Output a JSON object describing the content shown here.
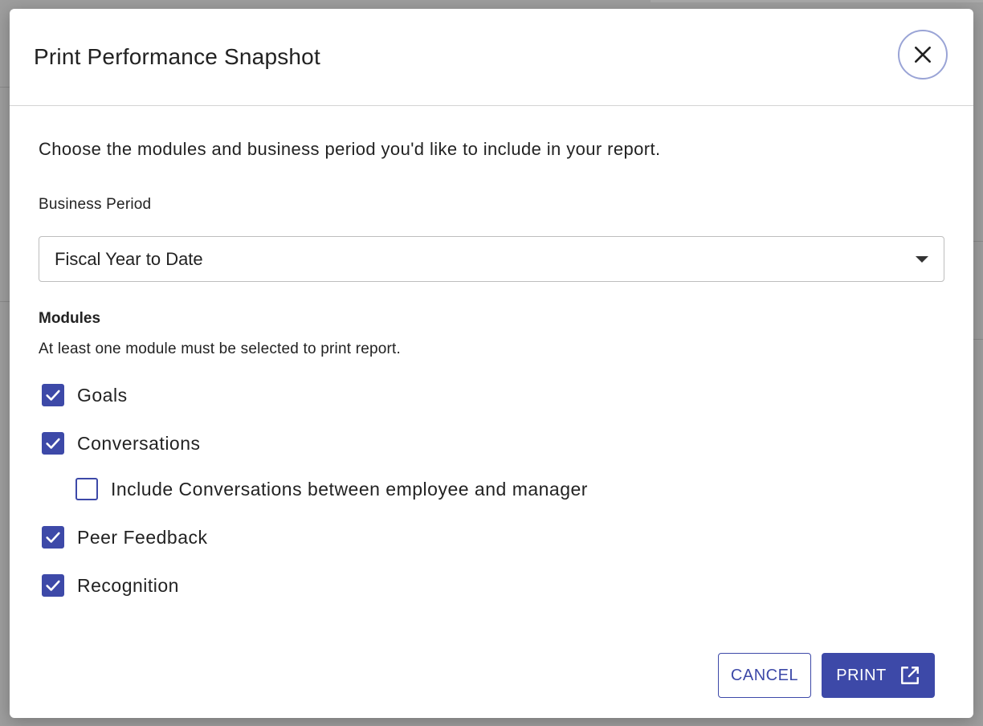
{
  "dialog": {
    "title": "Print Performance Snapshot",
    "intro": "Choose the modules and business period you'd like to include in your report."
  },
  "business_period": {
    "label": "Business Period",
    "selected": "Fiscal Year to Date"
  },
  "modules": {
    "title": "Modules",
    "help": "At least one module must be selected to print report.",
    "items": [
      {
        "label": "Goals",
        "checked": true
      },
      {
        "label": "Conversations",
        "checked": true
      },
      {
        "label": "Include Conversations between employee and manager",
        "checked": false
      },
      {
        "label": "Peer Feedback",
        "checked": true
      },
      {
        "label": "Recognition",
        "checked": true
      }
    ]
  },
  "actions": {
    "cancel_label": "CANCEL",
    "print_label": "PRINT"
  },
  "colors": {
    "accent": "#3d49a8",
    "close_ring": "#9aa4d6"
  },
  "icons": {
    "close": "close-icon",
    "caret": "caret-down-icon",
    "check": "check-icon",
    "external": "open-in-new-icon"
  }
}
